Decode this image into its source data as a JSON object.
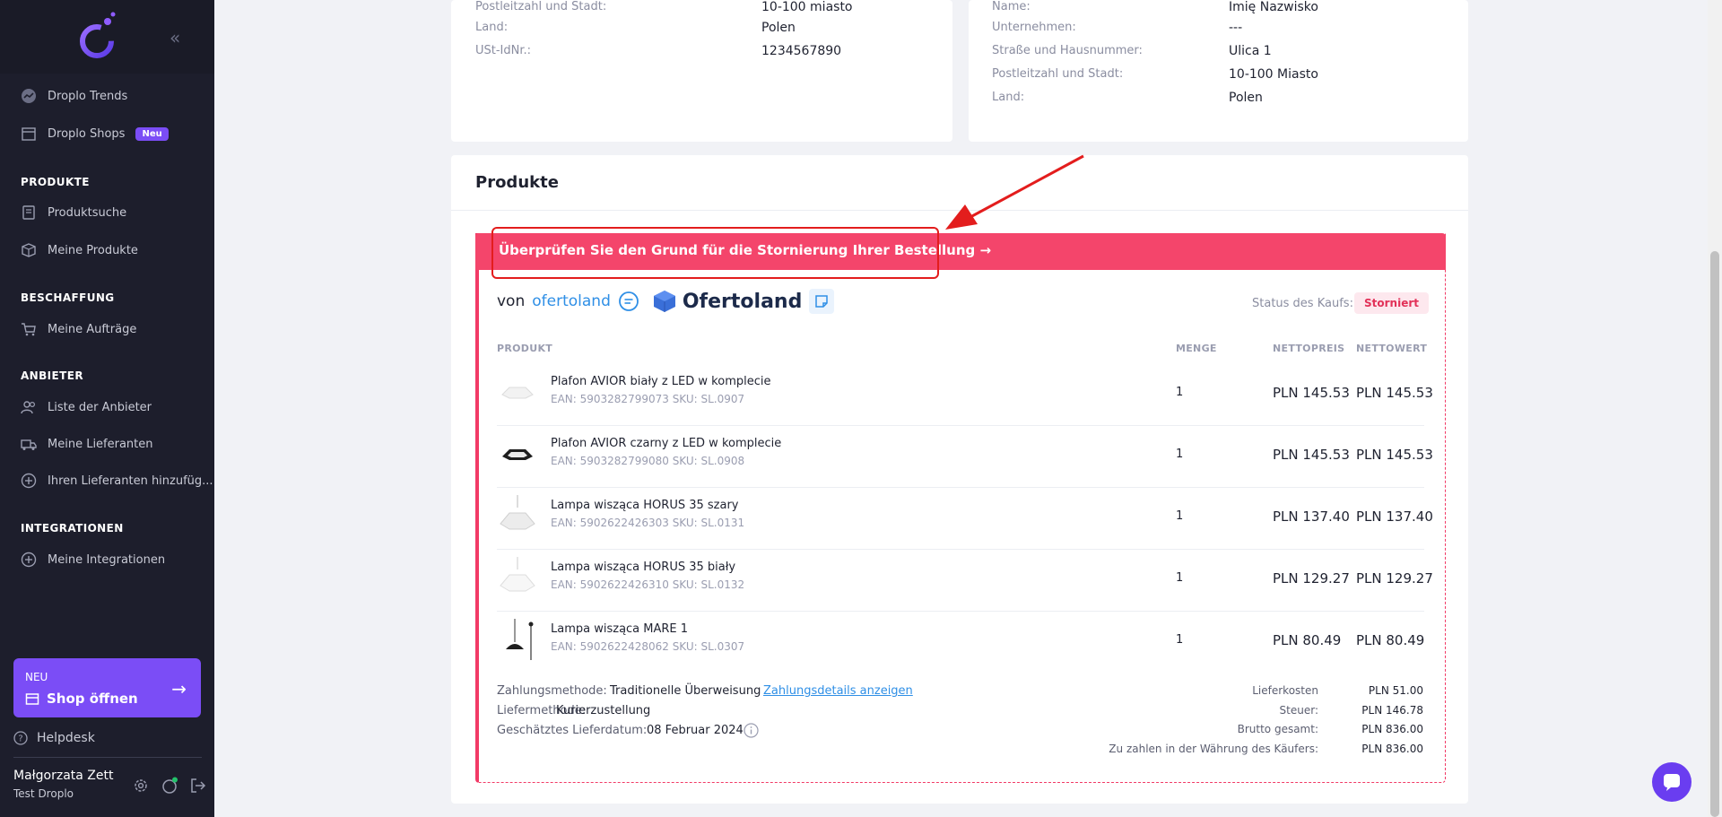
{
  "sidebar": {
    "items_top": [
      {
        "label": "Droplo Trends",
        "icon": "trend-icon"
      },
      {
        "label": "Droplo Shops",
        "icon": "store-icon",
        "badge": "Neu"
      }
    ],
    "sections": [
      {
        "title": "PRODUKTE",
        "items": [
          "Produktsuche",
          "Meine Produkte"
        ]
      },
      {
        "title": "BESCHAFFUNG",
        "items": [
          "Meine Aufträge"
        ]
      },
      {
        "title": "ANBIETER",
        "items": [
          "Liste der Anbieter",
          "Meine Lieferanten",
          "Ihren Lieferanten hinzufüg..."
        ]
      },
      {
        "title": "INTEGRATIONEN",
        "items": [
          "Meine Integrationen"
        ]
      }
    ],
    "shop_card": {
      "tag": "NEU",
      "label": "Shop öffnen"
    },
    "helpdesk": "Helpdesk",
    "user": {
      "name": "Małgorzata Zett",
      "shop": "Test Droplo"
    }
  },
  "address_left": {
    "labels": [
      "Postleitzahl und Stadt:",
      "Land:",
      "USt-IdNr.:"
    ],
    "values": [
      "10-100 miasto",
      "Polen",
      "1234567890"
    ]
  },
  "address_right": {
    "labels": [
      "Name:",
      "Unternehmen:",
      "Straße und Hausnummer:",
      "Postleitzahl und Stadt:",
      "Land:"
    ],
    "values": [
      "Imię Nazwisko",
      "---",
      "Ulica 1",
      "10-100 Miasto",
      "Polen"
    ]
  },
  "products": {
    "title": "Produkte",
    "cancel_banner": "Überprüfen Sie den Grund für die Stornierung Ihrer Bestellung →",
    "vendor_prefix": "von",
    "vendor_link": "ofertoland",
    "brand_name": "Ofertoland",
    "status_label": "Status des Kaufs:",
    "status_value": "Storniert",
    "headers": {
      "product": "PRODUKT",
      "qty": "MENGE",
      "net_price": "NETTOPREIS",
      "net_value": "NETTOWERT"
    },
    "rows": [
      {
        "name": "Plafon AVIOR biały z LED w komplecie",
        "meta": "EAN: 5903282799073   SKU: SL.0907",
        "qty": "1",
        "price": "PLN 145.53",
        "total": "PLN 145.53"
      },
      {
        "name": "Plafon AVIOR czarny z LED w komplecie",
        "meta": "EAN: 5903282799080   SKU: SL.0908",
        "qty": "1",
        "price": "PLN 145.53",
        "total": "PLN 145.53"
      },
      {
        "name": "Lampa wisząca HORUS 35 szary",
        "meta": "EAN: 5902622426303   SKU: SL.0131",
        "qty": "1",
        "price": "PLN 137.40",
        "total": "PLN 137.40"
      },
      {
        "name": "Lampa wisząca HORUS 35 biały",
        "meta": "EAN: 5902622426310   SKU: SL.0132",
        "qty": "1",
        "price": "PLN 129.27",
        "total": "PLN 129.27"
      },
      {
        "name": "Lampa wisząca MARE 1",
        "meta": "EAN: 5902622428062   SKU: SL.0307",
        "qty": "1",
        "price": "PLN 80.49",
        "total": "PLN 80.49"
      }
    ],
    "payment": {
      "method_label": "Zahlungsmethode:",
      "method_value": "Traditionelle Überweisung",
      "details_link": "Zahlungsdetails anzeigen",
      "delivery_label": "Liefermethode:",
      "delivery_value": "Kurierzustellung",
      "date_label": "Geschätztes Lieferdatum:",
      "date_value": "08 Februar 2024"
    },
    "summary": [
      {
        "label": "Lieferkosten",
        "value": "PLN 51.00"
      },
      {
        "label": "Steuer:",
        "value": "PLN 146.78"
      },
      {
        "label": "Brutto gesamt:",
        "value": "PLN 836.00"
      },
      {
        "label": "Zu zahlen in der Währung des Käufers:",
        "value": "PLN 836.00"
      }
    ]
  },
  "colors": {
    "accent": "#7b4df6",
    "danger": "#f4456b",
    "link": "#2f8fe6",
    "sidebar_bg": "#1d1e2c"
  }
}
